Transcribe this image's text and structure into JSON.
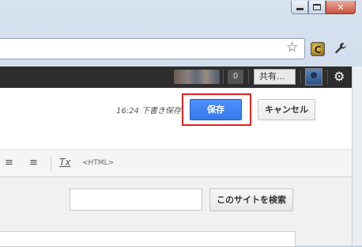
{
  "window": {
    "minimize_glyph": "▭",
    "maximize_glyph": "▢",
    "close_glyph": "✕"
  },
  "toolbar": {
    "star_glyph": "☆",
    "extension_glyph": "C",
    "wrench_glyph": "🔧"
  },
  "google_bar": {
    "notification_count": "0",
    "share_label": "共有...",
    "gear_glyph": "⚙"
  },
  "editor": {
    "save_status": "16:24 下書き保存",
    "save_label": "保存",
    "cancel_label": "キャンセル",
    "align_center_glyph": "≡",
    "align_right_glyph": "≡",
    "clear_format_glyph": "Tx",
    "html_label": "<HTML>"
  },
  "sidebar": {
    "search_button_label": "このサイトを検索",
    "search_value": ""
  },
  "colors": {
    "accent_blue": "#4d90fe",
    "highlight_red": "#e02020",
    "google_bar": "#2d2d2d"
  }
}
